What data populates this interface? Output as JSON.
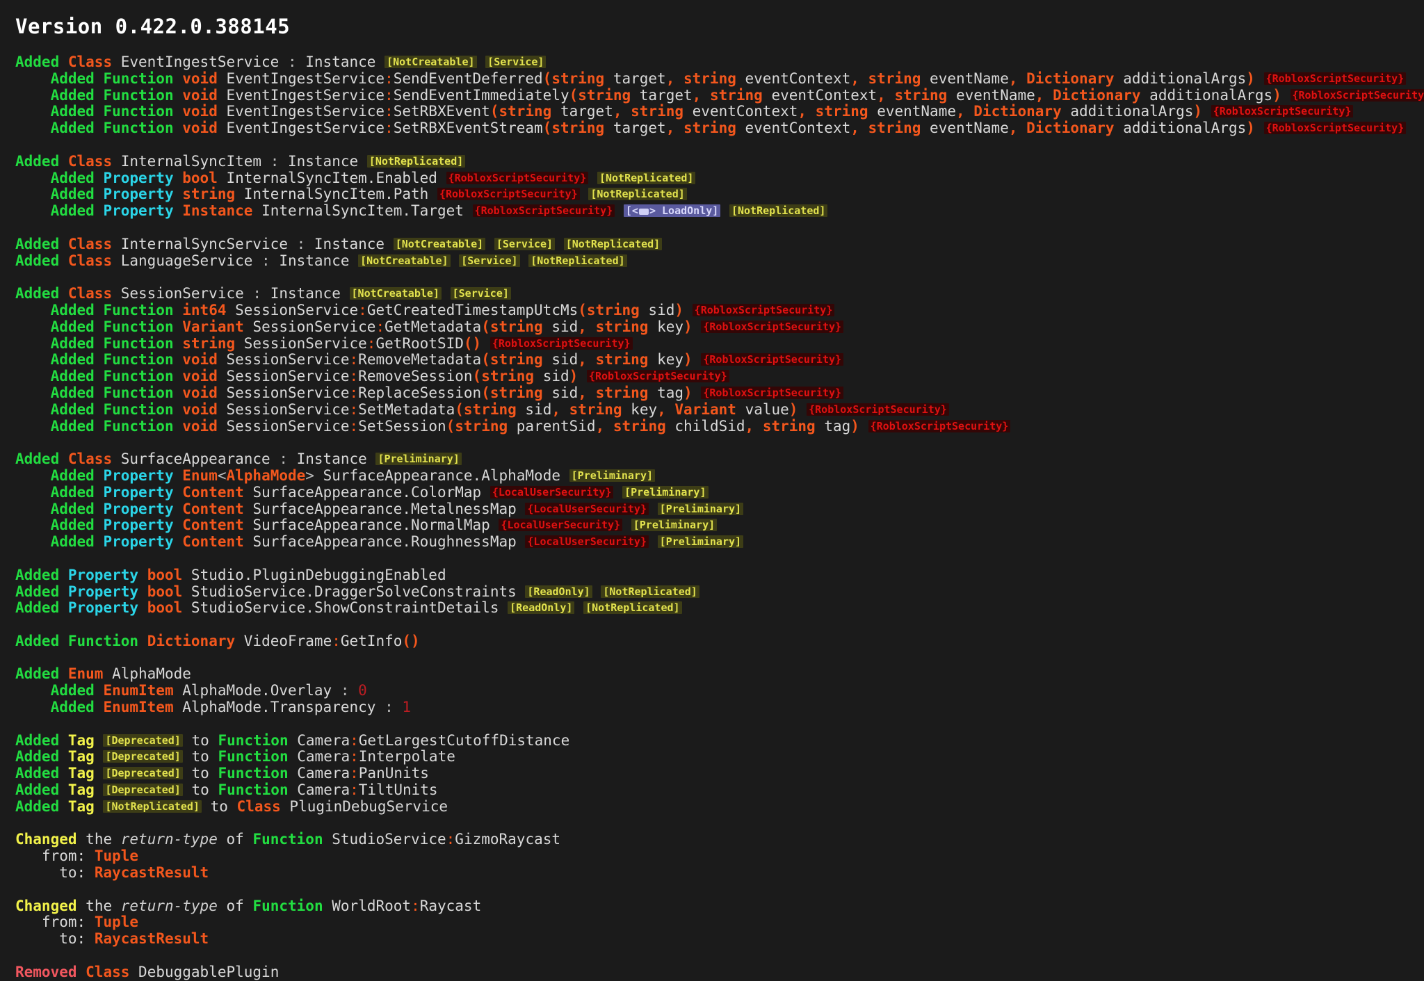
{
  "page": {
    "title": "Version 0.422.0.388145",
    "background": "#1b1b1b"
  },
  "colors": {
    "added": "#22dd41",
    "changed": "#f2f24a",
    "removed": "#f2575f",
    "class_type": "#f3571d",
    "function_type": "#22dd41",
    "property_type": "#2bd5e8",
    "identifier": "#d8d8d8",
    "number": "#bd1d22",
    "tag_badge_bg": "#3d3d16",
    "tag_badge_fg": "#e2e24e",
    "security_badge_bg": "#330606",
    "security_badge_fg": "#e01111",
    "loadonly_badge_bg": "#5a5a9e",
    "loadonly_badge_fg": "#d8d8fb"
  },
  "labels": {
    "added": "Added",
    "changed": "Changed",
    "removed": "Removed",
    "tag": "Tag",
    "the": "the",
    "of": "of",
    "to": "to",
    "from_label": "from:",
    "to_label": "to:",
    "return_type": "return-type",
    "class": "Class",
    "function": "Function",
    "property": "Property",
    "enum": "Enum",
    "enumitem": "EnumItem",
    "instance": "Instance",
    "colon_sep": " : "
  },
  "badges": {
    "not_creatable": "[NotCreatable]",
    "service": "[Service]",
    "not_replicated": "[NotReplicated]",
    "preliminary": "[Preliminary]",
    "deprecated": "[Deprecated]",
    "read_only": "[ReadOnly]",
    "roblox_script_security": "{RobloxScriptSecurity}",
    "local_user_security": "{LocalUserSecurity}",
    "load_only_prefix": "[<",
    "load_only_suffix": "> LoadOnly]",
    "load_only_icon": "document-icon"
  },
  "entries": [
    {
      "id": "class-eventingestservice",
      "kind": "class",
      "action": "Added",
      "type": "Class",
      "name": "EventIngestService",
      "super": "Instance",
      "tags": [
        "[NotCreatable]",
        "[Service]"
      ]
    },
    {
      "id": "fn-sendeventdeferred",
      "kind": "function",
      "indent": 1,
      "action": "Added",
      "type": "Function",
      "return_type": "void",
      "name": "EventIngestService:SendEventDeferred",
      "params": [
        {
          "type": "string",
          "name": "target"
        },
        {
          "type": "string",
          "name": "eventContext"
        },
        {
          "type": "string",
          "name": "eventName"
        },
        {
          "type": "Dictionary",
          "name": "additionalArgs"
        }
      ],
      "security": [
        "{RobloxScriptSecurity}"
      ]
    },
    {
      "id": "fn-sendeventimmediately",
      "kind": "function",
      "indent": 1,
      "action": "Added",
      "type": "Function",
      "return_type": "void",
      "name": "EventIngestService:SendEventImmediately",
      "params": [
        {
          "type": "string",
          "name": "target"
        },
        {
          "type": "string",
          "name": "eventContext"
        },
        {
          "type": "string",
          "name": "eventName"
        },
        {
          "type": "Dictionary",
          "name": "additionalArgs"
        }
      ],
      "security": [
        "{RobloxScriptSecurity}"
      ]
    },
    {
      "id": "fn-setrbxevent",
      "kind": "function",
      "indent": 1,
      "action": "Added",
      "type": "Function",
      "return_type": "void",
      "name": "EventIngestService:SetRBXEvent",
      "params": [
        {
          "type": "string",
          "name": "target"
        },
        {
          "type": "string",
          "name": "eventContext"
        },
        {
          "type": "string",
          "name": "eventName"
        },
        {
          "type": "Dictionary",
          "name": "additionalArgs"
        }
      ],
      "security": [
        "{RobloxScriptSecurity}"
      ]
    },
    {
      "id": "fn-setrbxeventstream",
      "kind": "function",
      "indent": 1,
      "action": "Added",
      "type": "Function",
      "return_type": "void",
      "name": "EventIngestService:SetRBXEventStream",
      "params": [
        {
          "type": "string",
          "name": "target"
        },
        {
          "type": "string",
          "name": "eventContext"
        },
        {
          "type": "string",
          "name": "eventName"
        },
        {
          "type": "Dictionary",
          "name": "additionalArgs"
        }
      ],
      "security": [
        "{RobloxScriptSecurity}"
      ]
    },
    {
      "id": "blank-1",
      "kind": "blank"
    },
    {
      "id": "class-internalsyncitem",
      "kind": "class",
      "action": "Added",
      "type": "Class",
      "name": "InternalSyncItem",
      "super": "Instance",
      "tags": [
        "[NotReplicated]"
      ]
    },
    {
      "id": "prop-internalsyncitem-enabled",
      "kind": "property",
      "indent": 1,
      "action": "Added",
      "type": "Property",
      "value_type": "bool",
      "name": "InternalSyncItem.Enabled",
      "security": [
        "{RobloxScriptSecurity}"
      ],
      "tags": [
        "[NotReplicated]"
      ]
    },
    {
      "id": "prop-internalsyncitem-path",
      "kind": "property",
      "indent": 1,
      "action": "Added",
      "type": "Property",
      "value_type": "string",
      "name": "InternalSyncItem.Path",
      "security": [
        "{RobloxScriptSecurity}"
      ],
      "tags": [
        "[NotReplicated]"
      ]
    },
    {
      "id": "prop-internalsyncitem-target",
      "kind": "property",
      "indent": 1,
      "action": "Added",
      "type": "Property",
      "value_type": "Instance",
      "name": "InternalSyncItem.Target",
      "security": [
        "{RobloxScriptSecurity}"
      ],
      "load_only": true,
      "tags": [
        "[NotReplicated]"
      ]
    },
    {
      "id": "blank-2",
      "kind": "blank"
    },
    {
      "id": "class-internalsyncservice",
      "kind": "class",
      "action": "Added",
      "type": "Class",
      "name": "InternalSyncService",
      "super": "Instance",
      "tags": [
        "[NotCreatable]",
        "[Service]",
        "[NotReplicated]"
      ]
    },
    {
      "id": "class-languageservice",
      "kind": "class",
      "action": "Added",
      "type": "Class",
      "name": "LanguageService",
      "super": "Instance",
      "tags": [
        "[NotCreatable]",
        "[Service]",
        "[NotReplicated]"
      ]
    },
    {
      "id": "blank-3",
      "kind": "blank"
    },
    {
      "id": "class-sessionservice",
      "kind": "class",
      "action": "Added",
      "type": "Class",
      "name": "SessionService",
      "super": "Instance",
      "tags": [
        "[NotCreatable]",
        "[Service]"
      ]
    },
    {
      "id": "fn-getcreatedtimestamputcms",
      "kind": "function",
      "indent": 1,
      "action": "Added",
      "type": "Function",
      "return_type": "int64",
      "name": "SessionService:GetCreatedTimestampUtcMs",
      "params": [
        {
          "type": "string",
          "name": "sid"
        }
      ],
      "security": [
        "{RobloxScriptSecurity}"
      ]
    },
    {
      "id": "fn-getmetadata",
      "kind": "function",
      "indent": 1,
      "action": "Added",
      "type": "Function",
      "return_type": "Variant",
      "name": "SessionService:GetMetadata",
      "params": [
        {
          "type": "string",
          "name": "sid"
        },
        {
          "type": "string",
          "name": "key"
        }
      ],
      "security": [
        "{RobloxScriptSecurity}"
      ]
    },
    {
      "id": "fn-getrootsid",
      "kind": "function",
      "indent": 1,
      "action": "Added",
      "type": "Function",
      "return_type": "string",
      "name": "SessionService:GetRootSID",
      "params": [],
      "security": [
        "{RobloxScriptSecurity}"
      ]
    },
    {
      "id": "fn-removemetadata",
      "kind": "function",
      "indent": 1,
      "action": "Added",
      "type": "Function",
      "return_type": "void",
      "name": "SessionService:RemoveMetadata",
      "params": [
        {
          "type": "string",
          "name": "sid"
        },
        {
          "type": "string",
          "name": "key"
        }
      ],
      "security": [
        "{RobloxScriptSecurity}"
      ]
    },
    {
      "id": "fn-removesession",
      "kind": "function",
      "indent": 1,
      "action": "Added",
      "type": "Function",
      "return_type": "void",
      "name": "SessionService:RemoveSession",
      "params": [
        {
          "type": "string",
          "name": "sid"
        }
      ],
      "security": [
        "{RobloxScriptSecurity}"
      ]
    },
    {
      "id": "fn-replacesession",
      "kind": "function",
      "indent": 1,
      "action": "Added",
      "type": "Function",
      "return_type": "void",
      "name": "SessionService:ReplaceSession",
      "params": [
        {
          "type": "string",
          "name": "sid"
        },
        {
          "type": "string",
          "name": "tag"
        }
      ],
      "security": [
        "{RobloxScriptSecurity}"
      ]
    },
    {
      "id": "fn-setmetadata",
      "kind": "function",
      "indent": 1,
      "action": "Added",
      "type": "Function",
      "return_type": "void",
      "name": "SessionService:SetMetadata",
      "params": [
        {
          "type": "string",
          "name": "sid"
        },
        {
          "type": "string",
          "name": "key"
        },
        {
          "type": "Variant",
          "name": "value"
        }
      ],
      "security": [
        "{RobloxScriptSecurity}"
      ]
    },
    {
      "id": "fn-setsession",
      "kind": "function",
      "indent": 1,
      "action": "Added",
      "type": "Function",
      "return_type": "void",
      "name": "SessionService:SetSession",
      "params": [
        {
          "type": "string",
          "name": "parentSid"
        },
        {
          "type": "string",
          "name": "childSid"
        },
        {
          "type": "string",
          "name": "tag"
        }
      ],
      "security": [
        "{RobloxScriptSecurity}"
      ]
    },
    {
      "id": "blank-4",
      "kind": "blank"
    },
    {
      "id": "class-surfaceappearance",
      "kind": "class",
      "action": "Added",
      "type": "Class",
      "name": "SurfaceAppearance",
      "super": "Instance",
      "tags": [
        "[Preliminary]"
      ]
    },
    {
      "id": "prop-surfaceappearance-alphamode",
      "kind": "property",
      "indent": 1,
      "action": "Added",
      "type": "Property",
      "value_type": "Enum<AlphaMode>",
      "name": "SurfaceAppearance.AlphaMode",
      "tags": [
        "[Preliminary]"
      ]
    },
    {
      "id": "prop-surfaceappearance-colormap",
      "kind": "property",
      "indent": 1,
      "action": "Added",
      "type": "Property",
      "value_type": "Content",
      "name": "SurfaceAppearance.ColorMap",
      "security": [
        "{LocalUserSecurity}"
      ],
      "tags": [
        "[Preliminary]"
      ]
    },
    {
      "id": "prop-surfaceappearance-metalnessmap",
      "kind": "property",
      "indent": 1,
      "action": "Added",
      "type": "Property",
      "value_type": "Content",
      "name": "SurfaceAppearance.MetalnessMap",
      "security": [
        "{LocalUserSecurity}"
      ],
      "tags": [
        "[Preliminary]"
      ]
    },
    {
      "id": "prop-surfaceappearance-normalmap",
      "kind": "property",
      "indent": 1,
      "action": "Added",
      "type": "Property",
      "value_type": "Content",
      "name": "SurfaceAppearance.NormalMap",
      "security": [
        "{LocalUserSecurity}"
      ],
      "tags": [
        "[Preliminary]"
      ]
    },
    {
      "id": "prop-surfaceappearance-roughnessmap",
      "kind": "property",
      "indent": 1,
      "action": "Added",
      "type": "Property",
      "value_type": "Content",
      "name": "SurfaceAppearance.RoughnessMap",
      "security": [
        "{LocalUserSecurity}"
      ],
      "tags": [
        "[Preliminary]"
      ]
    },
    {
      "id": "blank-5",
      "kind": "blank"
    },
    {
      "id": "prop-studio-plugindebuggingenabled",
      "kind": "property",
      "indent": 0,
      "action": "Added",
      "type": "Property",
      "value_type": "bool",
      "name": "Studio.PluginDebuggingEnabled",
      "tags": []
    },
    {
      "id": "prop-studioservice-draggersolveconstraints",
      "kind": "property",
      "indent": 0,
      "action": "Added",
      "type": "Property",
      "value_type": "bool",
      "name": "StudioService.DraggerSolveConstraints",
      "tags": [
        "[ReadOnly]",
        "[NotReplicated]"
      ]
    },
    {
      "id": "prop-studioservice-showconstraintdetails",
      "kind": "property",
      "indent": 0,
      "action": "Added",
      "type": "Property",
      "value_type": "bool",
      "name": "StudioService.ShowConstraintDetails",
      "tags": [
        "[ReadOnly]",
        "[NotReplicated]"
      ]
    },
    {
      "id": "blank-6",
      "kind": "blank"
    },
    {
      "id": "fn-videoframe-getinfo",
      "kind": "function",
      "indent": 0,
      "action": "Added",
      "type": "Function",
      "return_type": "Dictionary",
      "name": "VideoFrame:GetInfo",
      "params": [],
      "security": []
    },
    {
      "id": "blank-7",
      "kind": "blank"
    },
    {
      "id": "enum-alphamode",
      "kind": "enum",
      "action": "Added",
      "type": "Enum",
      "name": "AlphaMode"
    },
    {
      "id": "enumitem-alphamode-overlay",
      "kind": "enumitem",
      "indent": 1,
      "action": "Added",
      "type": "EnumItem",
      "name": "AlphaMode.Overlay",
      "value": "0"
    },
    {
      "id": "enumitem-alphamode-transparency",
      "kind": "enumitem",
      "indent": 1,
      "action": "Added",
      "type": "EnumItem",
      "name": "AlphaMode.Transparency",
      "value": "1"
    },
    {
      "id": "blank-8",
      "kind": "blank"
    },
    {
      "id": "tag-camera-getlargestcutoffdistance",
      "kind": "tag",
      "action": "Added",
      "tag_badge": "[Deprecated]",
      "target_type": "Function",
      "target_name": "Camera:GetLargestCutoffDistance"
    },
    {
      "id": "tag-camera-interpolate",
      "kind": "tag",
      "action": "Added",
      "tag_badge": "[Deprecated]",
      "target_type": "Function",
      "target_name": "Camera:Interpolate"
    },
    {
      "id": "tag-camera-panunits",
      "kind": "tag",
      "action": "Added",
      "tag_badge": "[Deprecated]",
      "target_type": "Function",
      "target_name": "Camera:PanUnits"
    },
    {
      "id": "tag-camera-tiltunits",
      "kind": "tag",
      "action": "Added",
      "tag_badge": "[Deprecated]",
      "target_type": "Function",
      "target_name": "Camera:TiltUnits"
    },
    {
      "id": "tag-plugindebugservice",
      "kind": "tag",
      "action": "Added",
      "tag_badge": "[NotReplicated]",
      "target_type": "Class",
      "target_name": "PluginDebugService"
    },
    {
      "id": "blank-9",
      "kind": "blank"
    },
    {
      "id": "changed-studioservice-gizmoraycast",
      "kind": "changed",
      "action": "Changed",
      "what": "return-type",
      "target_type": "Function",
      "target_name": "StudioService:GizmoRaycast",
      "from": "Tuple",
      "to": "RaycastResult"
    },
    {
      "id": "blank-10",
      "kind": "blank"
    },
    {
      "id": "changed-worldroot-raycast",
      "kind": "changed",
      "action": "Changed",
      "what": "return-type",
      "target_type": "Function",
      "target_name": "WorldRoot:Raycast",
      "from": "Tuple",
      "to": "RaycastResult"
    },
    {
      "id": "blank-11",
      "kind": "blank"
    },
    {
      "id": "removed-debuggableplugin",
      "kind": "removed",
      "action": "Removed",
      "type": "Class",
      "name": "DebuggablePlugin"
    }
  ]
}
